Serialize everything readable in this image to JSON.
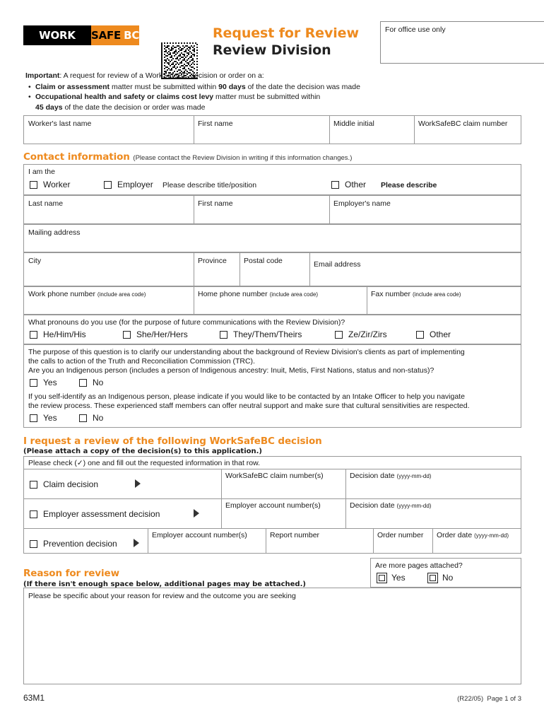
{
  "header": {
    "logo": {
      "work": "WORK",
      "safe": "SAFE",
      "bc": "BC"
    },
    "title_main": "Request for Review",
    "title_sub": "Review Division",
    "office_use": "For office use only"
  },
  "important": {
    "lead_label": "Important",
    "lead_text": ": A request for review of a WorkSafeBC decision or order on a:",
    "bullet1_bold": "Claim or assessment",
    "bullet1_mid": " matter must be submitted within ",
    "bullet1_days": "90 days",
    "bullet1_end": " of the date the decision was made",
    "bullet2_bold": "Occupational health and safety or claims cost levy",
    "bullet2_mid": " matter must be submitted within",
    "bullet2_days": "45 days",
    "bullet2_end": " of the date the decision or order was made"
  },
  "worker_row": {
    "last_name": "Worker's last name",
    "first_name": "First name",
    "middle_initial": "Middle initial",
    "claim_number": "WorkSafeBC claim number"
  },
  "contact": {
    "heading": "Contact information",
    "heading_note": "(Please contact the Review Division in writing if this information changes.)",
    "i_am_the": "I am the",
    "worker_cb": "Worker",
    "employer_cb": "Employer",
    "employer_describe": "Please describe title/position",
    "other_cb": "Other",
    "other_describe": "Please describe",
    "last_name": "Last name",
    "first_name": "First name",
    "employers_name": "Employer's name",
    "mailing_address": "Mailing address",
    "city": "City",
    "province": "Province",
    "postal_code": "Postal code",
    "email": "Email address",
    "work_phone": "Work phone number",
    "work_phone_note": "(include area code)",
    "home_phone": "Home phone number",
    "home_phone_note": "(include area code)",
    "fax": "Fax number",
    "fax_note": "(include area code)"
  },
  "pronouns": {
    "question": "What pronouns do you use (for the purpose of future communications with the Review Division)?",
    "options": [
      "He/Him/His",
      "She/Her/Hers",
      "They/Them/Theirs",
      "Ze/Zir/Zirs",
      "Other"
    ]
  },
  "indigenous": {
    "purpose_line1": "The purpose of this question is to clarify our understanding about the background of Review Division's clients as part of implementing",
    "purpose_line2": "the calls to action of the Truth and Reconciliation Commission (TRC).",
    "question1": "Are you an Indigenous person (includes a person of Indigenous ancestry: Inuit, Metis, First Nations, status and non-status)?",
    "q1_yes": "Yes",
    "q1_no": "No",
    "intake_line1": "If you self-identify as an Indigenous person, please indicate if you would like to be contacted by an Intake Officer to help you navigate",
    "intake_line2": "the review process. These experienced staff members can offer neutral support and make sure that cultural sensitivities are respected.",
    "q2_yes": "Yes",
    "q2_no": "No"
  },
  "decision": {
    "heading": "I request a review of the following WorkSafeBC decision",
    "subheading": "(Please attach a copy of the decision(s) to this application.)",
    "instruction": "Please check (✓) one and fill out the requested information in that row.",
    "row1_label": "Claim decision",
    "row1_col1": "WorkSafeBC claim number(s)",
    "row1_col2": "Decision date",
    "row1_col2_note": "(yyyy-mm-dd)",
    "row2_label": "Employer assessment decision",
    "row2_col1": "Employer account number(s)",
    "row2_col2": "Decision date",
    "row2_col2_note": "(yyyy-mm-dd)",
    "row3_label": "Prevention decision",
    "row3_col1": "Employer account number(s)",
    "row3_col2": "Report number",
    "row3_col3": "Order number",
    "row3_col4": "Order date",
    "row3_col4_note": "(yyyy-mm-dd)"
  },
  "reason": {
    "heading": "Reason for review",
    "subheading": "(If there isn't enough space below, additional pages may be attached.)",
    "pages_question": "Are more pages attached?",
    "pages_yes": "Yes",
    "pages_no": "No",
    "placeholder": "Please be specific about your reason for review and the outcome you are seeking"
  },
  "footer": {
    "form_code": "63M1",
    "revision": "(R22/05)",
    "page": "Page 1 of 3"
  },
  "colors": {
    "brand_orange": "#EE8A1E",
    "black": "#000000",
    "rule": "#999999"
  }
}
